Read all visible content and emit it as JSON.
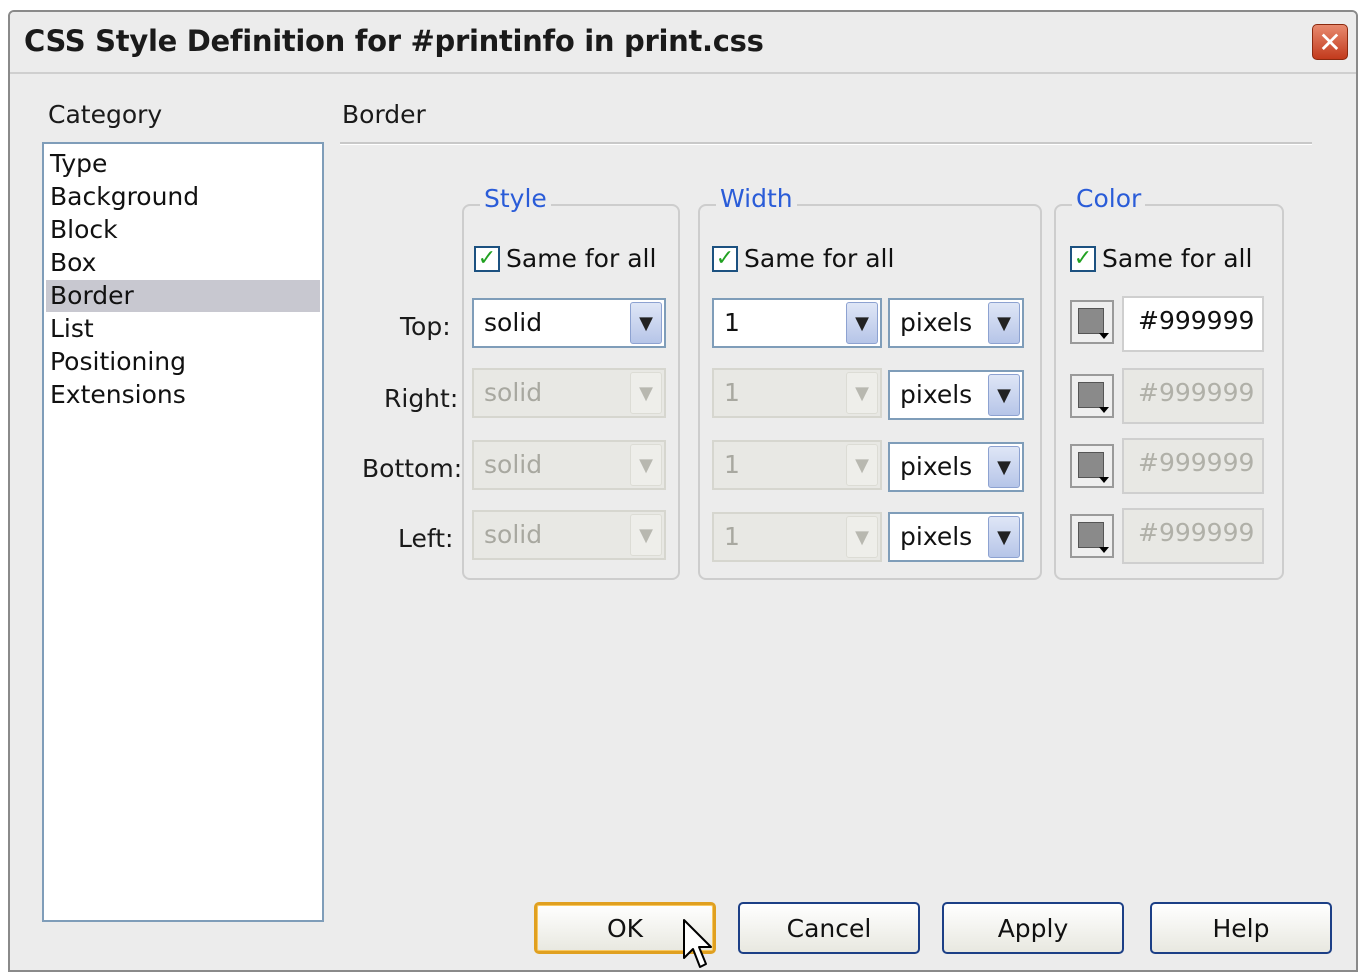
{
  "window": {
    "title": "CSS Style Definition for #printinfo in print.css",
    "close_glyph": "✕"
  },
  "category": {
    "label": "Category",
    "items": [
      "Type",
      "Background",
      "Block",
      "Box",
      "Border",
      "List",
      "Positioning",
      "Extensions"
    ],
    "selected": "Border"
  },
  "section": {
    "title": "Border"
  },
  "groups": {
    "style": {
      "legend": "Style",
      "same_for_all": "Same for all",
      "checked": true
    },
    "width": {
      "legend": "Width",
      "same_for_all": "Same for all",
      "checked": true
    },
    "color": {
      "legend": "Color",
      "same_for_all": "Same for all",
      "checked": true
    }
  },
  "rows": [
    {
      "label": "Top:",
      "style": "solid",
      "width": "1",
      "unit": "pixels",
      "color": "#999999",
      "enabled": true
    },
    {
      "label": "Right:",
      "style": "solid",
      "width": "1",
      "unit": "pixels",
      "color": "#999999",
      "enabled": false
    },
    {
      "label": "Bottom:",
      "style": "solid",
      "width": "1",
      "unit": "pixels",
      "color": "#999999",
      "enabled": false
    },
    {
      "label": "Left:",
      "style": "solid",
      "width": "1",
      "unit": "pixels",
      "color": "#999999",
      "enabled": false
    }
  ],
  "buttons": {
    "ok": "OK",
    "cancel": "Cancel",
    "apply": "Apply",
    "help": "Help"
  },
  "icons": {
    "checkmark": "✓",
    "dropdown": "▼",
    "close": "close-icon",
    "cursor": "mouse-pointer-icon"
  }
}
